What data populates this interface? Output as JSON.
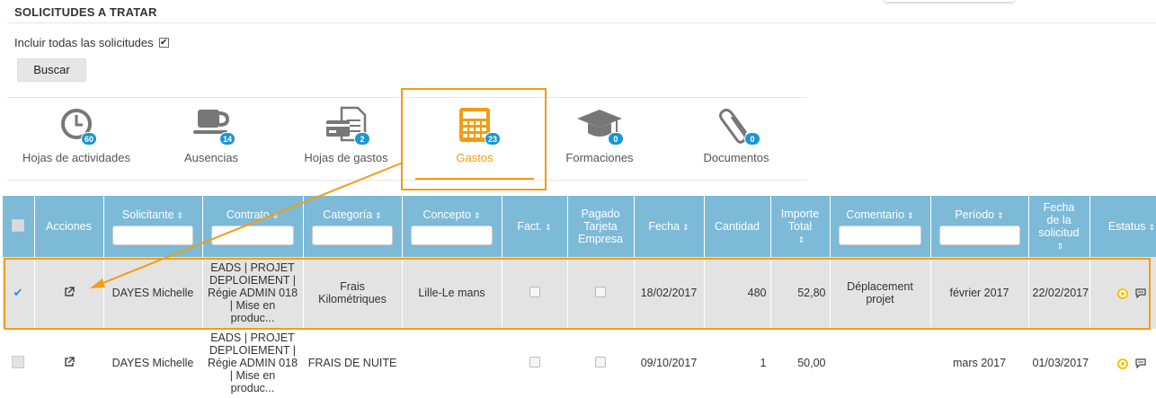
{
  "page": {
    "title": "SOLICITUDES A TRATAR",
    "include_label": "Incluir todas las solicitudes",
    "include_checked": true,
    "search_button": "Buscar"
  },
  "tabs": [
    {
      "label": "Hojas de actividades",
      "count": "60",
      "icon": "clock-icon"
    },
    {
      "label": "Ausencias",
      "count": "14",
      "icon": "cup-icon"
    },
    {
      "label": "Hojas de gastos",
      "count": "2",
      "icon": "expense-sheet-icon"
    },
    {
      "label": "Gastos",
      "count": "23",
      "icon": "calculator-icon",
      "active": true
    },
    {
      "label": "Formaciones",
      "count": "0",
      "icon": "graduation-cap-icon"
    },
    {
      "label": "Documentos",
      "count": "0",
      "icon": "paperclip-icon"
    }
  ],
  "table": {
    "headers": {
      "acciones": "Acciones",
      "solicitante": "Solicitante",
      "contrato": "Contrato",
      "categoria": "Categoría",
      "concepto": "Concepto",
      "fact": "Fact.",
      "pagado_1": "Pagado",
      "pagado_2": "Tarjeta",
      "pagado_3": "Empresa",
      "fecha": "Fecha",
      "cantidad": "Cantidad",
      "importe_1": "Importe",
      "importe_2": "Total",
      "comentario": "Comentario",
      "periodo": "Período",
      "fsol_1": "Fecha",
      "fsol_2": "de la",
      "fsol_3": "solicitud",
      "estatus": "Estatus"
    },
    "rows": [
      {
        "selected": true,
        "solicitante": "DAYES Michelle",
        "contrato_1": "EADS | PROJET",
        "contrato_2": "DEPLOIEMENT |",
        "contrato_3": "Régie ADMIN 018",
        "contrato_4": "| Mise en",
        "contrato_5": "produc...",
        "categoria_1": "Frais",
        "categoria_2": "Kilométriques",
        "concepto": "Lille-Le mans",
        "fecha": "18/02/2017",
        "cantidad": "480",
        "importe": "52,80",
        "comentario_1": "Déplacement",
        "comentario_2": "projet",
        "periodo": "février 2017",
        "fecha_solicitud": "22/02/2017"
      },
      {
        "selected": false,
        "solicitante": "DAYES Michelle",
        "contrato_1": "EADS | PROJET",
        "contrato_2": "DEPLOIEMENT |",
        "contrato_3": "Régie ADMIN 018",
        "contrato_4": "| Mise en",
        "contrato_5": "produc...",
        "categoria_1": "FRAIS DE NUITE",
        "categoria_2": "",
        "concepto": "",
        "fecha": "09/10/2017",
        "cantidad": "1",
        "importe": "50,00",
        "comentario_1": "",
        "comentario_2": "",
        "periodo": "mars 2017",
        "fecha_solicitud": "01/03/2017"
      }
    ]
  },
  "colors": {
    "accent": "#f39c12",
    "header_bg": "#7cbad8",
    "badge": "#1a96d1",
    "status": "#f5c400"
  }
}
